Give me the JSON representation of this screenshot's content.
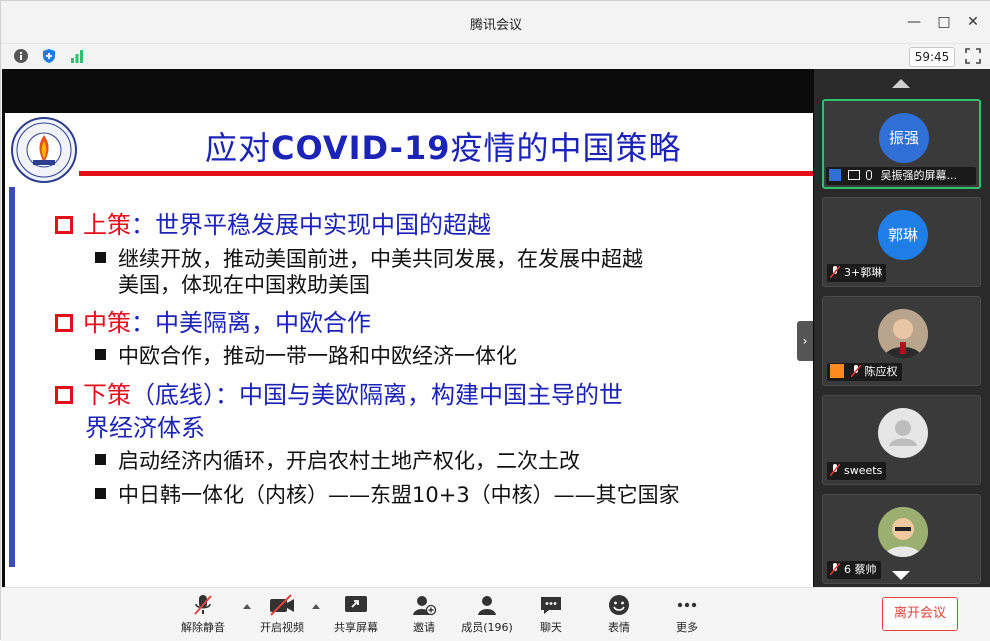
{
  "window": {
    "title": "腾讯会议"
  },
  "infobar": {
    "timer": "59:45"
  },
  "slide": {
    "title_prefix": "应对",
    "title_bold": "COVID-19",
    "title_suffix": "疫情的中国策略",
    "items": [
      {
        "head": "上策",
        "text": "：世界平稳发展中实现中国的超越"
      },
      {
        "head": "中策",
        "text": "：中美隔离，中欧合作"
      },
      {
        "head": "下策",
        "text": "（底线）：中国与美欧隔离，构建中国主导的世",
        "text2": "界经济体系"
      }
    ],
    "subitems": [
      "继续开放，推动美国前进，中美共同发展，在发展中超越",
      "美国，体现在中国救助美国",
      "中欧合作，推动一带一路和中欧经济一体化",
      "启动经济内循环，开启农村土地产权化，二次土改",
      "中日韩一体化（内核）——东盟10+3（中核）——其它国家"
    ]
  },
  "participants": [
    {
      "avatar_text": "振强",
      "name": "吴振强的屏幕...",
      "color": "#2f6fd6"
    },
    {
      "avatar_text": "郭琳",
      "name": "3+郭琳",
      "color": "#1f7ee8"
    },
    {
      "avatar_text": "",
      "name": "陈应权",
      "color": "#777"
    },
    {
      "avatar_text": "",
      "name": "sweets",
      "color": "#e6e6e6"
    },
    {
      "avatar_text": "",
      "name": "6 蔡帅",
      "color": "#777"
    }
  ],
  "toolbar": {
    "mute": "解除静音",
    "video": "开启视频",
    "share": "共享屏幕",
    "invite": "邀请",
    "members": "成员(196)",
    "chat": "聊天",
    "emoji": "表情",
    "more": "更多",
    "leave": "离开会议"
  }
}
